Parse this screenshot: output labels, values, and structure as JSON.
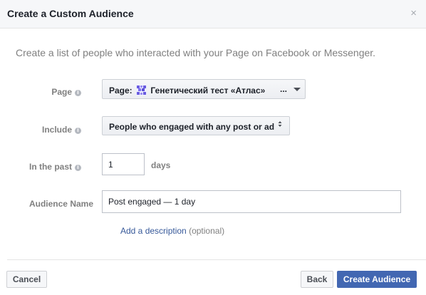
{
  "dialog": {
    "title": "Create a Custom Audience",
    "close_glyph": "×",
    "intro": "Create a list of people who interacted with your Page on Facebook or Messenger."
  },
  "form": {
    "page": {
      "label": "Page",
      "prefix": "Page:",
      "value": "Генетический тест «Атлас»",
      "ellipsis": "..."
    },
    "include": {
      "label": "Include",
      "value": "People who engaged with any post or ad",
      "arrows": "◆"
    },
    "in_the_past": {
      "label": "In the past",
      "value": "1",
      "unit": "days"
    },
    "audience_name": {
      "label": "Audience Name",
      "value": "Post engaged — 1 day"
    },
    "description": {
      "link": "Add a description",
      "optional": "(optional)"
    },
    "info_glyph": "i"
  },
  "footer": {
    "cancel": "Cancel",
    "back": "Back",
    "create": "Create Audience"
  },
  "colors": {
    "primary": "#4267b2",
    "link": "#365899"
  },
  "icons": {
    "page_icon": "atlas-logo-icon",
    "close": "close-icon",
    "info": "info-icon"
  }
}
